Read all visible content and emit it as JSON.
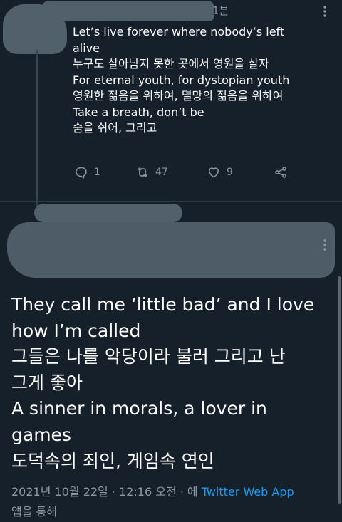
{
  "reply": {
    "time_fragment": "1분",
    "lines": [
      "Let’s live forever where nobody’s left",
      "alive",
      "누구도 살아남지 못한 곳에서 영원을 살자",
      "For eternal youth, for dystopian youth",
      "영원한 젊음을 위하여, 멸망의 젊음을 위하여",
      "Take a breath, don’t be",
      "숨을 쉬어, 그리고"
    ],
    "reply_count": "1",
    "retweet_count": "47",
    "like_count": "9"
  },
  "main": {
    "lines": [
      "They call me ‘little bad’ and I love",
      "how I’m called",
      "그들은 나를 악당이라 불러 그리고 난",
      "그게 좋아",
      "A sinner in morals, a lover in",
      "games",
      "도덕속의 죄인, 게임속 연인"
    ],
    "timestamp": "2021년 10월 22일 · 12:16 오전 · 에",
    "source_app": "Twitter Web App",
    "via_suffix": "앱을 통해"
  },
  "colors": {
    "background": "#15202b",
    "muted": "#8b98a5",
    "accent": "#1d9bf0"
  },
  "icons": [
    "more-dots-icon",
    "reply-icon",
    "retweet-icon",
    "like-icon",
    "share-icon"
  ]
}
